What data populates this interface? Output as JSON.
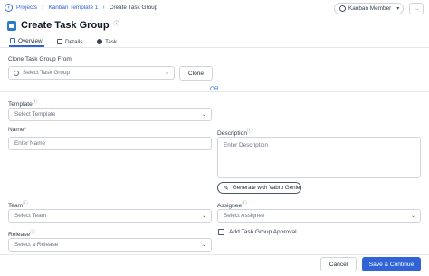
{
  "breadcrumb": {
    "items": [
      "Projects",
      "Kanban Template 1",
      "Create Task Group"
    ],
    "info_icon": "info-icon"
  },
  "header": {
    "member_label": "Kanban Member",
    "more_label": "..."
  },
  "page": {
    "title": "Create Task Group"
  },
  "tabs": [
    {
      "label": "Overview",
      "icon": "overview-icon",
      "active": true
    },
    {
      "label": "Details",
      "icon": "details-icon",
      "active": false
    },
    {
      "label": "Task",
      "icon": "task-icon",
      "active": false
    }
  ],
  "form": {
    "clone_label": "Clone Task Group From",
    "clone_placeholder": "Select Task Group",
    "clone_button": "Clone",
    "or_text": "OR",
    "template_label": "Template",
    "template_placeholder": "Select Template",
    "name_label": "Name",
    "name_required": "*",
    "name_placeholder": "Enter Name",
    "description_label": "Description",
    "description_placeholder": "Enter Description",
    "genie_button": "Generate with Vabro Genie",
    "team_label": "Team",
    "team_placeholder": "Select Team",
    "assignee_label": "Assignee",
    "assignee_placeholder": "Select Assignee",
    "release_label": "Release",
    "release_placeholder": "Select a Release",
    "approval_label": "Add Task Group Approval"
  },
  "footer": {
    "cancel": "Cancel",
    "save": "Save & Continue"
  },
  "colors": {
    "accent": "#2f63d6",
    "title_icon": "#2c7bc4",
    "required": "#dc2626"
  }
}
